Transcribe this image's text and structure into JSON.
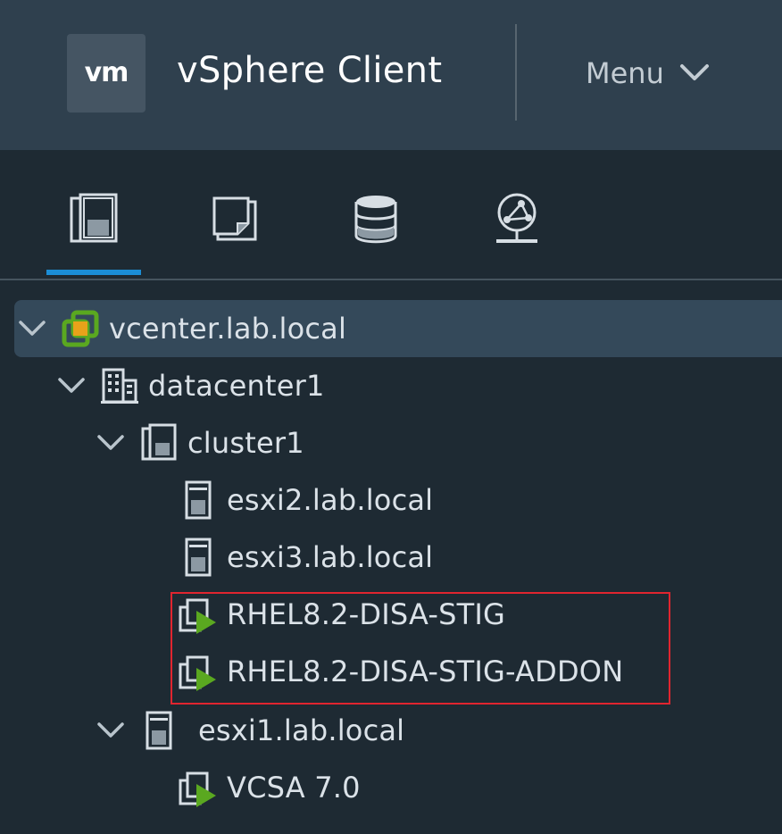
{
  "header": {
    "logo_text": "vm",
    "app_title": "vSphere Client",
    "menu_label": "Menu"
  },
  "tabs": [
    {
      "name": "hosts-and-clusters",
      "active": true
    },
    {
      "name": "vms-and-templates",
      "active": false
    },
    {
      "name": "storage",
      "active": false
    },
    {
      "name": "networking",
      "active": false
    }
  ],
  "tree": {
    "nodes": [
      {
        "label": "vcenter.lab.local",
        "type": "vcenter",
        "expanded": true,
        "selected": true
      },
      {
        "label": "datacenter1",
        "type": "datacenter",
        "expanded": true
      },
      {
        "label": "cluster1",
        "type": "cluster",
        "expanded": true
      },
      {
        "label": "esxi2.lab.local",
        "type": "host"
      },
      {
        "label": "esxi3.lab.local",
        "type": "host"
      },
      {
        "label": "RHEL8.2-DISA-STIG",
        "type": "vm-powered-on",
        "highlighted": true
      },
      {
        "label": "RHEL8.2-DISA-STIG-ADDON",
        "type": "vm-powered-on",
        "highlighted": true
      },
      {
        "label": "esxi1.lab.local",
        "type": "host",
        "expanded": true
      },
      {
        "label": "VCSA 7.0",
        "type": "vm-powered-on"
      }
    ]
  },
  "colors": {
    "header_bg": "#2f404e",
    "body_bg": "#1e2a33",
    "accent": "#1b8ed6",
    "vm_green": "#5aa820",
    "highlight": "#e0252f"
  }
}
